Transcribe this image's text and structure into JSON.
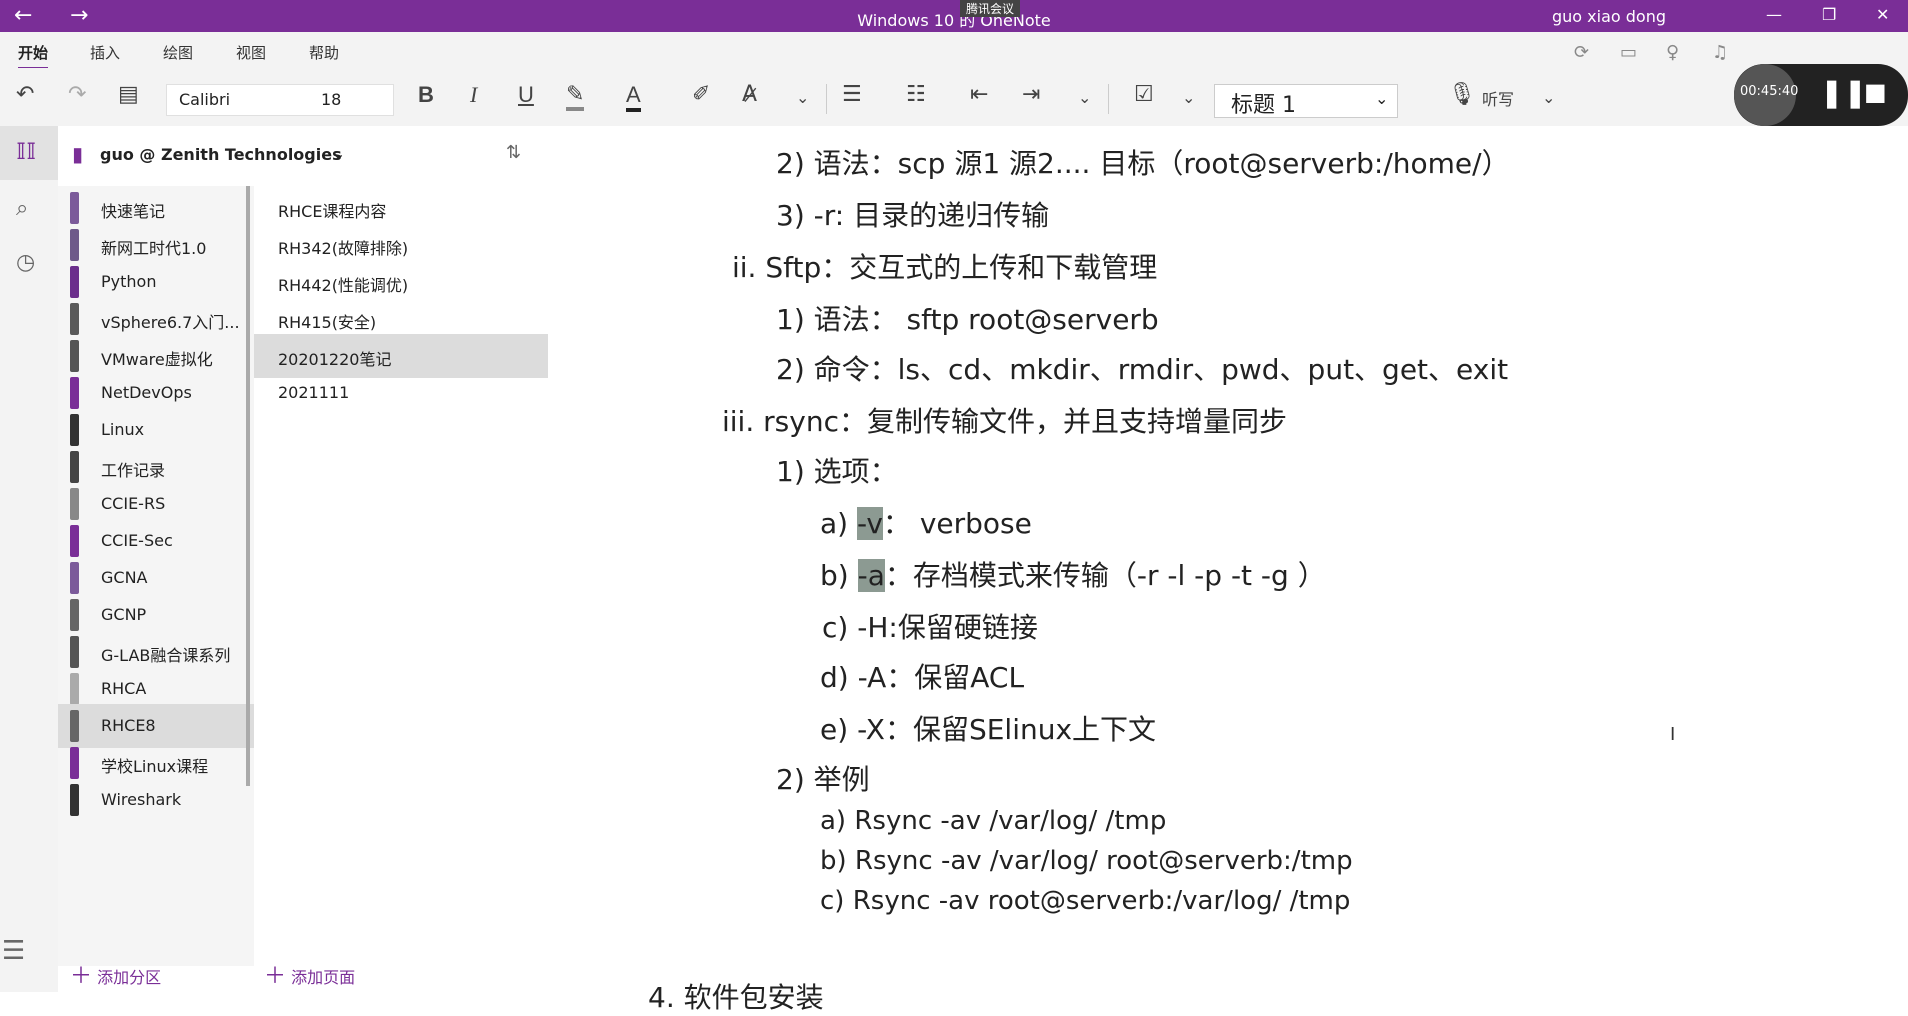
{
  "titlebar": {
    "title": "Windows 10 的 OneNote",
    "meeting": "腾讯会议",
    "user": "guo xiao dong",
    "back_icon": "←",
    "forward_icon": "→",
    "minimize": "—",
    "maximize": "❐",
    "close": "✕"
  },
  "menu": {
    "home": "开始",
    "insert": "插入",
    "draw": "绘图",
    "view": "视图",
    "help": "帮助"
  },
  "toolbar": {
    "font": "Calibri",
    "size": "18",
    "bold": "B",
    "italic": "I",
    "underline": "U",
    "style": "标题 1",
    "dictate": "听写"
  },
  "recording": {
    "time": "00:45:40"
  },
  "notebook": {
    "name": "guo @ Zenith Technologies"
  },
  "sections": [
    {
      "label": "快速笔记",
      "color": "#7b5a9a"
    },
    {
      "label": "新网工时代1.0",
      "color": "#6e5a8a"
    },
    {
      "label": "Python",
      "color": "#6b2e8c"
    },
    {
      "label": "vSphere6.7入门...",
      "color": "#5a5a5a"
    },
    {
      "label": "VMware虚拟化",
      "color": "#555555"
    },
    {
      "label": "NetDevOps",
      "color": "#7a2e97"
    },
    {
      "label": "Linux",
      "color": "#333333"
    },
    {
      "label": "工作记录",
      "color": "#444444"
    },
    {
      "label": "CCIE-RS",
      "color": "#888888"
    },
    {
      "label": "CCIE-Sec",
      "color": "#7a2e97"
    },
    {
      "label": "GCNA",
      "color": "#7b5a9a"
    },
    {
      "label": "GCNP",
      "color": "#666666"
    },
    {
      "label": "G-LAB融合课系列",
      "color": "#555555"
    },
    {
      "label": "RHCA",
      "color": "#aaaaaa"
    },
    {
      "label": "RHCE8",
      "color": "#666666"
    },
    {
      "label": "学校Linux课程",
      "color": "#7a2e97"
    },
    {
      "label": "Wireshark",
      "color": "#333333"
    }
  ],
  "pages": [
    {
      "label": "RHCE课程内容"
    },
    {
      "label": "RH342(故障排除)"
    },
    {
      "label": "RH442(性能调优)"
    },
    {
      "label": "RH415(安全)"
    },
    {
      "label": "20201220笔记"
    },
    {
      "label": "2021111"
    }
  ],
  "add_section": "添加分区",
  "add_page": "添加页面",
  "note": {
    "l1": {
      "n": "2)",
      "t": "语法：scp 源1 源2....  目标（root@serverb:/home/）"
    },
    "l2": {
      "n": "3)",
      "t": "-r: 目录的递归传输"
    },
    "l3": {
      "n": "ii.",
      "t": "Sftp：交互式的上传和下载管理"
    },
    "l4": {
      "n": "1)",
      "t": "语法：  sftp root@serverb"
    },
    "l5": {
      "n": "2)",
      "t": "命令：ls、cd、mkdir、rmdir、pwd、put、get、exit"
    },
    "l6": {
      "n": "iii.",
      "t": "rsync：复制传输文件，并且支持增量同步"
    },
    "l7": {
      "n": "1)",
      "t": "选项："
    },
    "a": {
      "n": "a)",
      "opt": "-v",
      "t": "：  verbose"
    },
    "b": {
      "n": "b)",
      "opt": "-a",
      "t": "：存档模式来传输（-r  -l -p  -t  -g ）"
    },
    "c": {
      "n": "c)",
      "t": "-H:保留硬链接"
    },
    "d": {
      "n": "d)",
      "t": "-A：保留ACL"
    },
    "e": {
      "n": "e)",
      "t": "-X：保留SElinux上下文"
    },
    "l8": {
      "n": "2)",
      "t": "举例"
    },
    "ea": {
      "n": "a)",
      "t": "Rsync -av /var/log/ /tmp"
    },
    "eb": {
      "n": "b)",
      "t": "Rsync -av /var/log/ root@serverb:/tmp"
    },
    "ec": {
      "n": "c)",
      "t": "Rsync -av root@serverb:/var/log/ /tmp"
    },
    "last": "4.  软件包安装"
  }
}
